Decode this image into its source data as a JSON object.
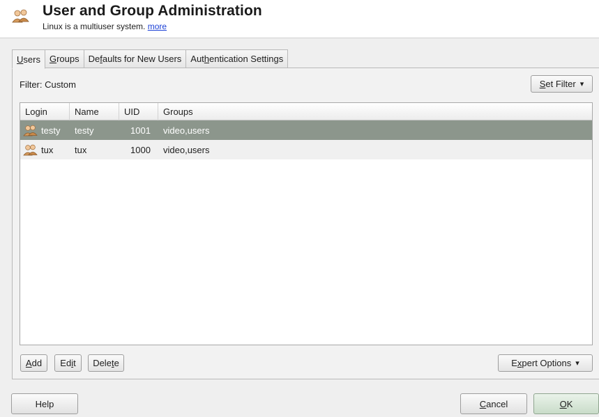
{
  "header": {
    "title": "User and Group Administration",
    "subtitle": "Linux is a multiuser system.",
    "more_link": "more",
    "icon": "users-icon"
  },
  "tabs": [
    {
      "label_pre": "",
      "label_key": "U",
      "label_post": "sers",
      "active": true
    },
    {
      "label_pre": "",
      "label_key": "G",
      "label_post": "roups",
      "active": false
    },
    {
      "label_pre": "De",
      "label_key": "f",
      "label_post": "aults for New Users",
      "active": false
    },
    {
      "label_pre": "Aut",
      "label_key": "h",
      "label_post": "entication Settings",
      "active": false
    }
  ],
  "filter": {
    "label": "Filter: Custom",
    "button_key": "S",
    "button_post": "et Filter",
    "chevron": "▾"
  },
  "table": {
    "columns": [
      "Login",
      "Name",
      "UID",
      "Groups"
    ],
    "rows": [
      {
        "login": "testy",
        "name": "testy",
        "uid": "1001",
        "groups": "video,users",
        "selected": true
      },
      {
        "login": "tux",
        "name": "tux",
        "uid": "1000",
        "groups": "video,users",
        "selected": false
      }
    ]
  },
  "actions": {
    "add_key": "A",
    "add_post": "dd",
    "edit_pre": "Ed",
    "edit_key": "i",
    "edit_post": "t",
    "delete_pre": "Dele",
    "delete_key": "t",
    "delete_post": "e",
    "expert_pre": "E",
    "expert_key": "x",
    "expert_post": "pert Options",
    "chevron": "▾"
  },
  "footer": {
    "help": "Help",
    "cancel_key": "C",
    "cancel_post": "ancel",
    "ok_key": "O",
    "ok_post": "K"
  },
  "colors": {
    "selected_row": "#8c968c",
    "link": "#1a3fd6",
    "panel_bg": "#efefef"
  }
}
